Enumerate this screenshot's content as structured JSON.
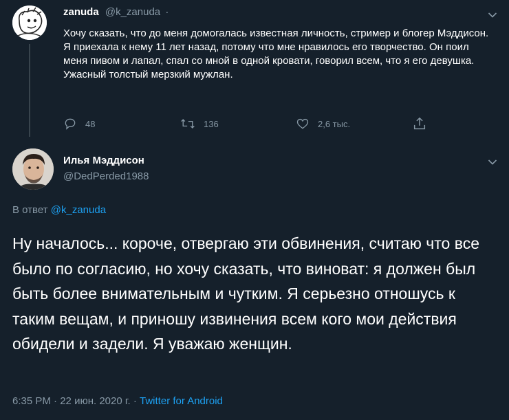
{
  "parent_tweet": {
    "display_name": "zanuda",
    "handle": "@k_zanuda",
    "separator": "·",
    "text": "Хочу сказать, что до меня домогалась известная личность, стример и блогер Мэддисон. Я приехала к нему 11 лет назад, потому что мне нравилось его творчество. Он поил меня пивом и лапал, спал со мной в одной кровати, говорил всем, что я его девушка. Ужасный толстый мерзкий мужлан.",
    "replies": "48",
    "retweets": "136",
    "likes": "2,6 тыс."
  },
  "main_tweet": {
    "display_name": "Илья Мэддисон",
    "handle": "@DedPerded1988",
    "reply_prefix": "В ответ",
    "reply_handle": "@k_zanuda",
    "text": "Ну началось...  короче, отвергаю эти обвинения, считаю что все было по согласию, но хочу сказать, что виноват: я должен был быть более внимательным и чутким. Я серьезно отношусь к таким вещам, и приношу извинения всем кого мои действия обидели и задели. Я уважаю женщин.",
    "time": "6:35 PM",
    "date": "22 июн. 2020 г.",
    "dot": "·",
    "source": "Twitter for Android"
  },
  "colors": {
    "background": "#15202b",
    "muted": "#8899a6",
    "link": "#1da1f2",
    "thread_line": "#38444d"
  },
  "icons": [
    "chevron-down-icon",
    "reply-icon",
    "retweet-icon",
    "like-icon",
    "share-icon"
  ]
}
